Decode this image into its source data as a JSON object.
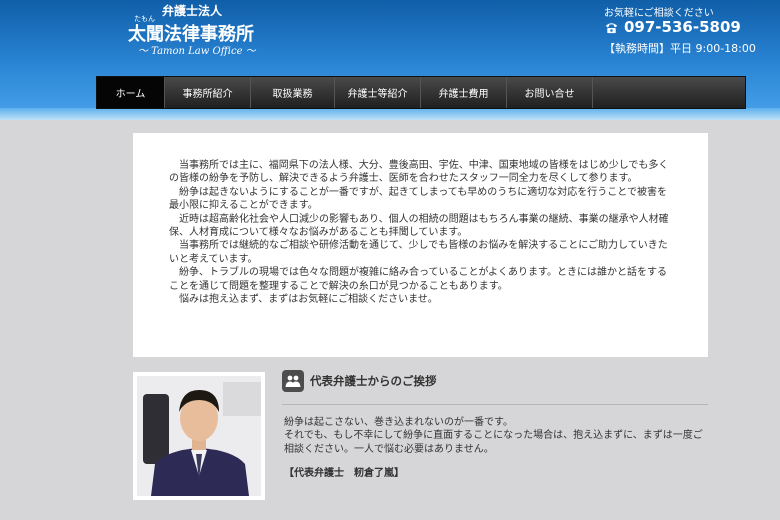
{
  "header": {
    "org": "弁護士法人",
    "ruby": "たもん",
    "name": "太聞法律事務所",
    "english": "〜 Tamon Law Office 〜",
    "contact_label": "お気軽にご相談ください",
    "phone": "097-536-5809",
    "hours": "【執務時間】平日 9:00-18:00",
    "phone_icon": "phone-icon"
  },
  "nav": {
    "items": [
      {
        "label": "ホーム"
      },
      {
        "label": "事務所紹介"
      },
      {
        "label": "取扱業務"
      },
      {
        "label": "弁護士等紹介"
      },
      {
        "label": "弁護士費用"
      },
      {
        "label": "お問い合せ"
      }
    ]
  },
  "intro": {
    "paragraphs": [
      "当事務所では主に、福岡県下の法人様、大分、豊後高田、宇佐、中津、国東地域の皆様をはじめ少しでも多くの皆様の紛争を予防し、解決できるよう弁護士、医師を合わせたスタッフ一同全力を尽くして参ります。",
      "紛争は起きないようにすることが一番ですが、起きてしまっても早めのうちに適切な対応を行うことで被害を最小限に抑えることができます。",
      "近時は超高齢化社会や人口減少の影響もあり、個人の相続の問題はもちろん事業の継続、事業の継承や人材確保、人材育成について様々なお悩みがあることも拝聞しています。",
      "当事務所では継続的なご相談や研修活動を通じて、少しでも皆様のお悩みを解決することにご助力していきたいと考えています。",
      "紛争、トラブルの現場では色々な問題が複雑に絡み合っていることがよくあります。ときには誰かと話をすることを通じて問題を整理することで解決の糸口が見つかることもあります。",
      "悩みは抱え込まず、まずはお気軽にご相談くださいませ。"
    ]
  },
  "greeting": {
    "title": "代表弁護士からのご挨拶",
    "icon": "people-icon",
    "lines": [
      "紛争は起こさない、巻き込まれないのが一番です。",
      "それでも、もし不幸にして紛争に直面することになった場合は、抱え込まずに、まずは一度ご相談ください。一人で悩む必要はありません。"
    ],
    "signature": "【代表弁護士　籾倉了嵐】"
  },
  "colors": {
    "header_blue": "#1f74c4",
    "nav_dark": "#2a2a2a",
    "nav_active": "#050505"
  }
}
